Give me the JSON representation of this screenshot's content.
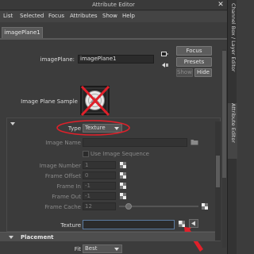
{
  "window": {
    "title": "Attribute Editor"
  },
  "menu": [
    "List",
    "Selected",
    "Focus",
    "Attributes",
    "Show",
    "Help"
  ],
  "tab": {
    "label": "imagePlane1"
  },
  "node": {
    "label": "imagePlane:",
    "value": "imagePlane1"
  },
  "buttons": {
    "focus": "Focus",
    "presets": "Presets",
    "show": "Show",
    "hide": "Hide"
  },
  "sample": {
    "label": "Image Plane Sample"
  },
  "type": {
    "label": "Type",
    "value": "Texture"
  },
  "image_name": {
    "label": "Image Name",
    "value": ""
  },
  "use_sequence": {
    "label": "Use Image Sequence"
  },
  "image_number": {
    "label": "Image Number",
    "value": "1"
  },
  "frame_offset": {
    "label": "Frame Offset",
    "value": "0"
  },
  "frame_in": {
    "label": "Frame In",
    "value": "-1"
  },
  "frame_out": {
    "label": "Frame Out",
    "value": "-1"
  },
  "frame_cache": {
    "label": "Frame Cache",
    "value": "12"
  },
  "texture": {
    "label": "Texture",
    "value": ""
  },
  "placement": {
    "label": "Placement"
  },
  "fit": {
    "label": "Fit",
    "value": "Best"
  },
  "side_tabs": {
    "channel_box": "Channel Box / Layer Editor",
    "attribute_editor": "Attribute Editor"
  },
  "annotation": {
    "color": "#e0202a"
  }
}
